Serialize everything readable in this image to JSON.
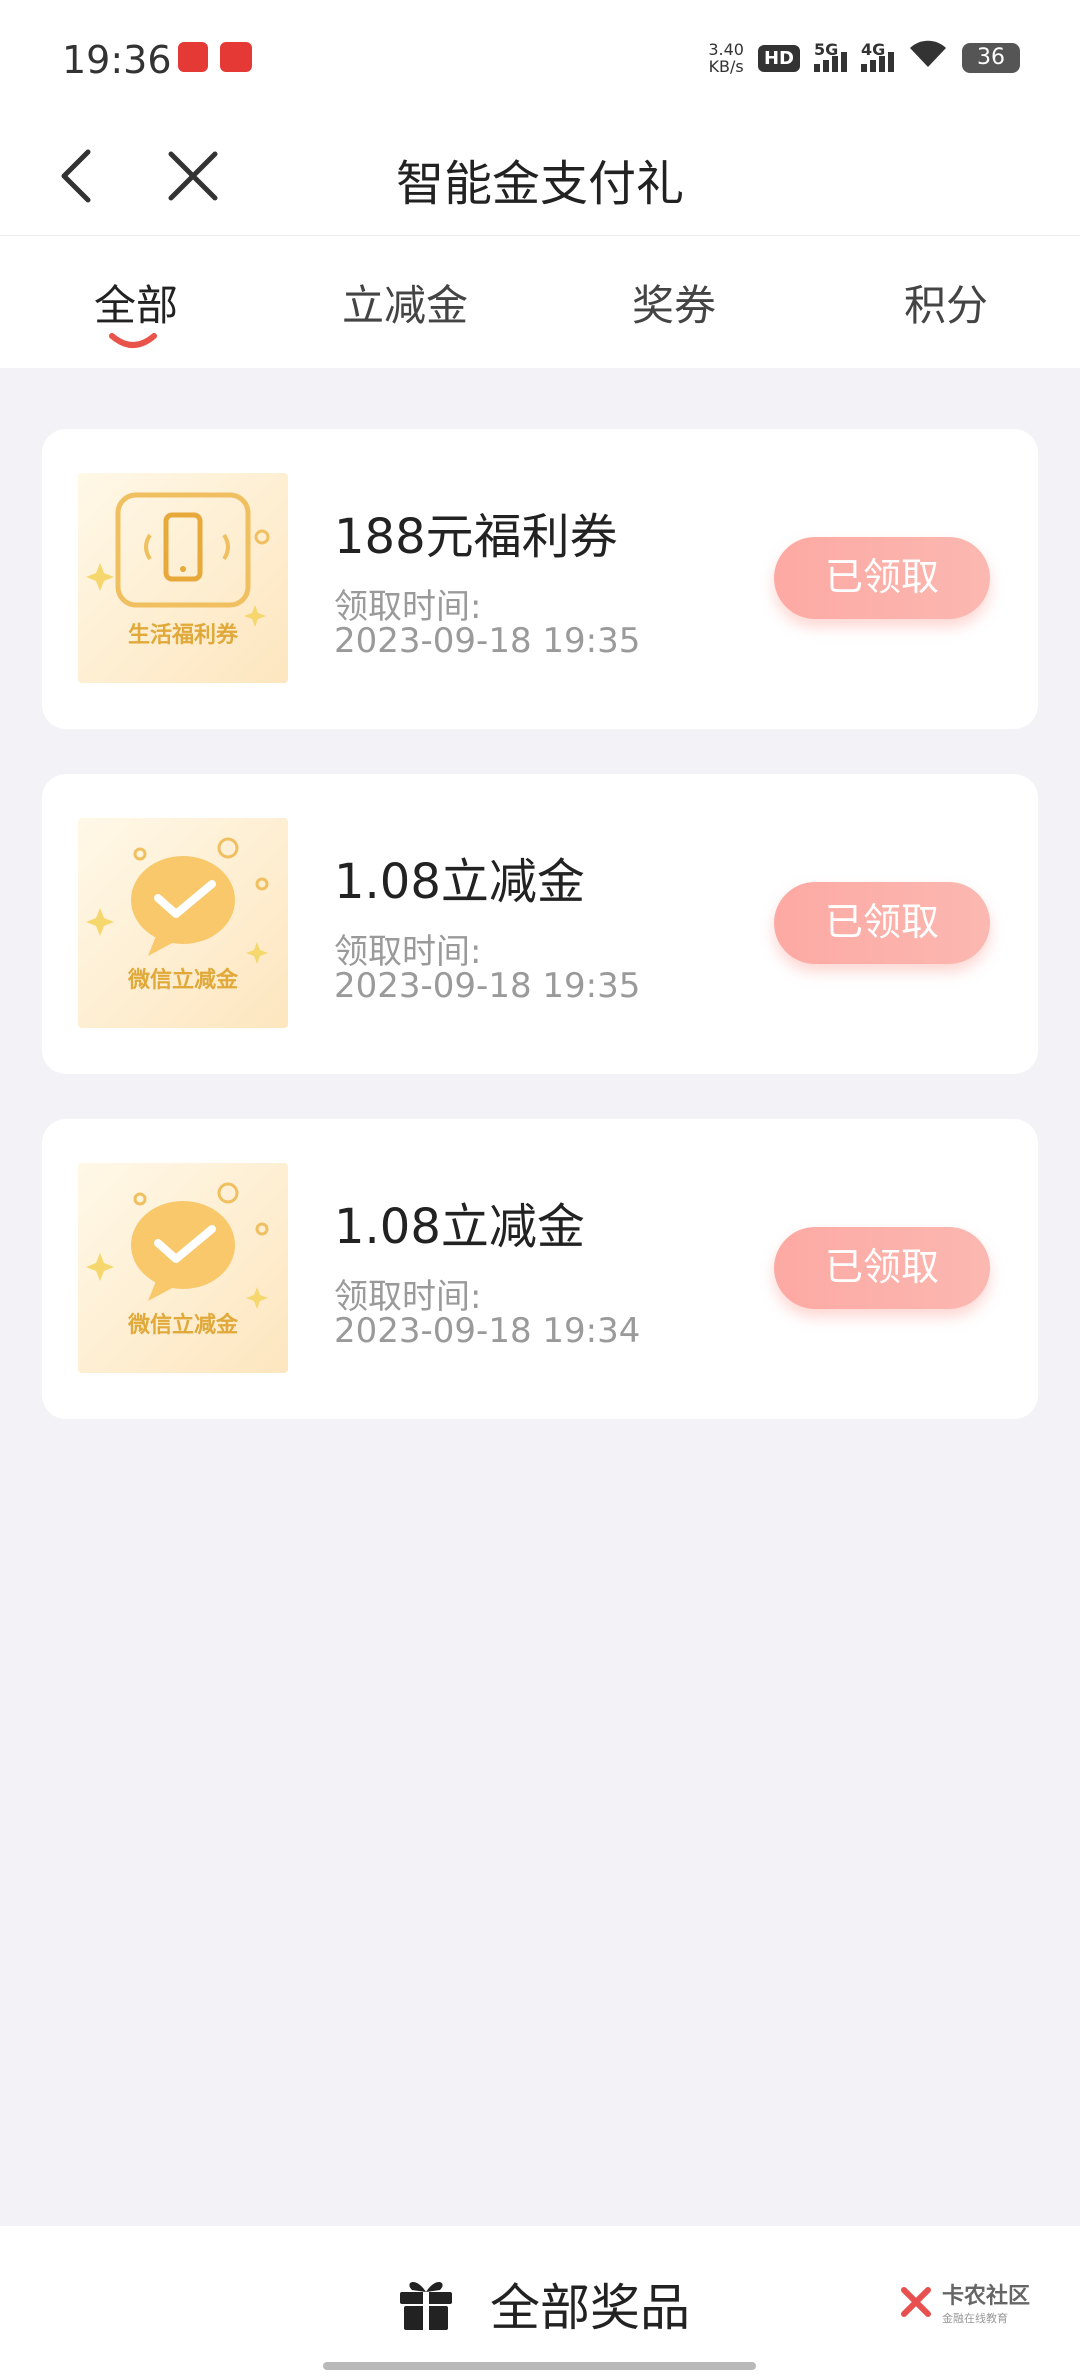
{
  "status_bar": {
    "time": "19:36",
    "speed_top": "3.40",
    "speed_unit": "KB/s",
    "hd": "HD",
    "sig1": "5G",
    "sig2": "4G",
    "battery": "36"
  },
  "header": {
    "title": "智能金支付礼"
  },
  "tabs": [
    {
      "label": "全部",
      "active": true
    },
    {
      "label": "立减金",
      "active": false
    },
    {
      "label": "奖券",
      "active": false
    },
    {
      "label": "积分",
      "active": false
    }
  ],
  "prizes": [
    {
      "name": "188元福利券",
      "time_label": "领取时间:",
      "time": "2023-09-18 19:35",
      "button": "已领取",
      "thumb_caption": "生活福利券",
      "icon": "phone-coupon-icon"
    },
    {
      "name": "1.08立减金",
      "time_label": "领取时间:",
      "time": "2023-09-18 19:35",
      "button": "已领取",
      "thumb_caption": "微信立减金",
      "icon": "wechat-pay-icon"
    },
    {
      "name": "1.08立减金",
      "time_label": "领取时间:",
      "time": "2023-09-18 19:34",
      "button": "已领取",
      "thumb_caption": "微信立减金",
      "icon": "wechat-pay-icon"
    }
  ],
  "bottom": {
    "label": "全部奖品",
    "watermark": "卡农社区",
    "watermark_sub": "金融在线教育"
  },
  "colors": {
    "accent": "#e8534a",
    "claimed_button": "#fda9a3",
    "page_bg": "#f3f2f7"
  }
}
